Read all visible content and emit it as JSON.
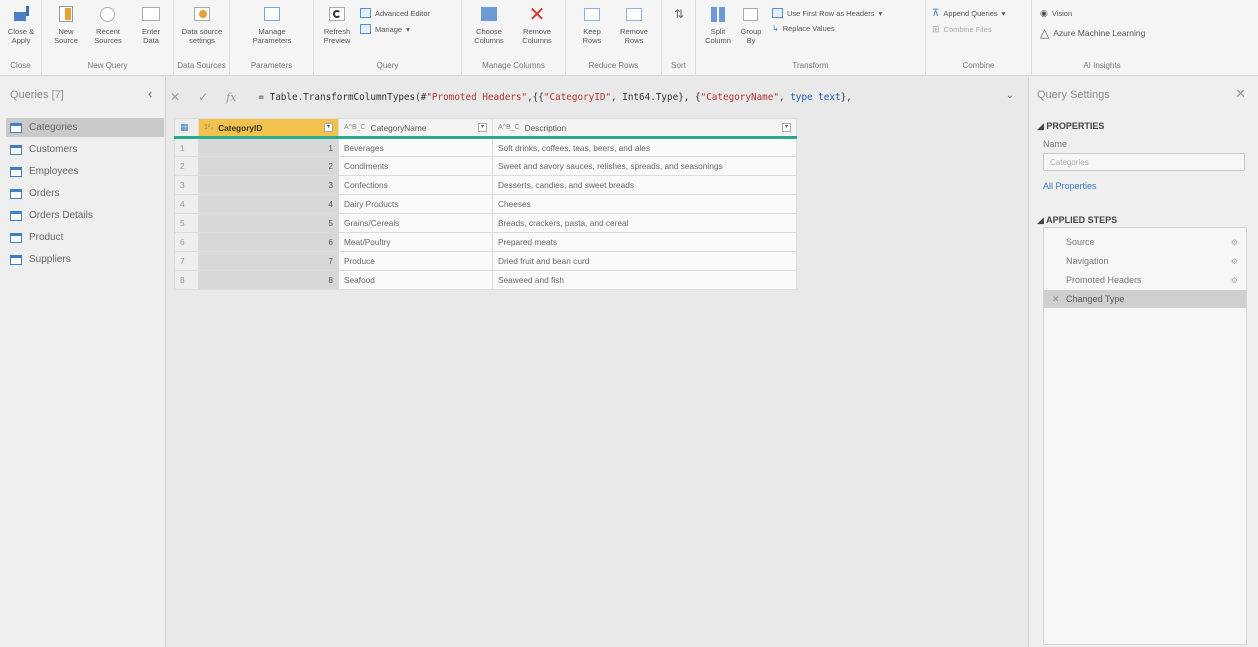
{
  "ribbon": {
    "close_group": {
      "close_apply": "Close & Apply",
      "label": "Close"
    },
    "new_query": {
      "new_source": "New Source",
      "recent_sources": "Recent Sources",
      "enter_data": "Enter Data",
      "label": "New Query"
    },
    "data_sources": {
      "settings": "Data source settings",
      "label": "Data Sources"
    },
    "parameters": {
      "manage": "Manage Parameters",
      "label": "Parameters"
    },
    "query": {
      "refresh": "Refresh Preview",
      "advanced_editor": "Advanced Editor",
      "manage": "Manage",
      "label": "Query"
    },
    "manage_columns": {
      "choose": "Choose Columns",
      "remove": "Remove Columns",
      "label": "Manage Columns"
    },
    "reduce_rows": {
      "keep": "Keep Rows",
      "remove": "Remove Rows",
      "label": "Reduce Rows"
    },
    "sort": {
      "label": "Sort"
    },
    "transform": {
      "split": "Split Column",
      "group_by": "Group By",
      "first_row_headers": "Use First Row as Headers",
      "replace_values": "Replace Values",
      "label": "Transform"
    },
    "combine": {
      "append": "Append Queries",
      "combine_files": "Combine Files",
      "label": "Combine"
    },
    "ai": {
      "vision": "Vision",
      "azure_ml": "Azure Machine Learning",
      "label": "AI Insights"
    }
  },
  "queries": {
    "title": "Queries [7]",
    "items": [
      "Categories",
      "Customers",
      "Employees",
      "Orders",
      "Orders Details",
      "Product",
      "Suppliers"
    ]
  },
  "formula": {
    "prefix": "= Table.TransformColumnTypes(#",
    "str1": "\"Promoted Headers\"",
    "mid1": ",{{",
    "str2": "\"CategoryID\"",
    "mid2": ", Int64.Type}, {",
    "str3": "\"CategoryName\"",
    "mid3": ", ",
    "kw": "type text",
    "suffix": "},"
  },
  "table": {
    "columns": [
      "CategoryID",
      "CategoryName",
      "Description"
    ],
    "column_types": [
      "1²₃",
      "A^B_C",
      "A^B_C"
    ],
    "rows": [
      [
        "1",
        "Beverages",
        "Soft drinks, coffees, teas, beers, and ales"
      ],
      [
        "2",
        "Condiments",
        "Sweet and savory sauces, relishes, spreads, and seasonings"
      ],
      [
        "3",
        "Confections",
        "Desserts, candies, and sweet breads"
      ],
      [
        "4",
        "Dairy Products",
        "Cheeses"
      ],
      [
        "5",
        "Grains/Cereals",
        "Breads, crackers, pasta, and cereal"
      ],
      [
        "6",
        "Meat/Poultry",
        "Prepared meats"
      ],
      [
        "7",
        "Produce",
        "Dried fruit and bean curd"
      ],
      [
        "8",
        "Seafood",
        "Seaweed and fish"
      ]
    ]
  },
  "settings": {
    "title": "Query Settings",
    "properties_header": "PROPERTIES",
    "name_label": "Name",
    "name_value": "Categories",
    "all_properties": "All Properties",
    "applied_steps_header": "APPLIED STEPS",
    "steps": [
      "Source",
      "Navigation",
      "Promoted Headers",
      "Changed Type"
    ]
  },
  "colors": {
    "accent": "#2aa98c",
    "selected_header": "#f2c24c",
    "link": "#3b79c4"
  }
}
